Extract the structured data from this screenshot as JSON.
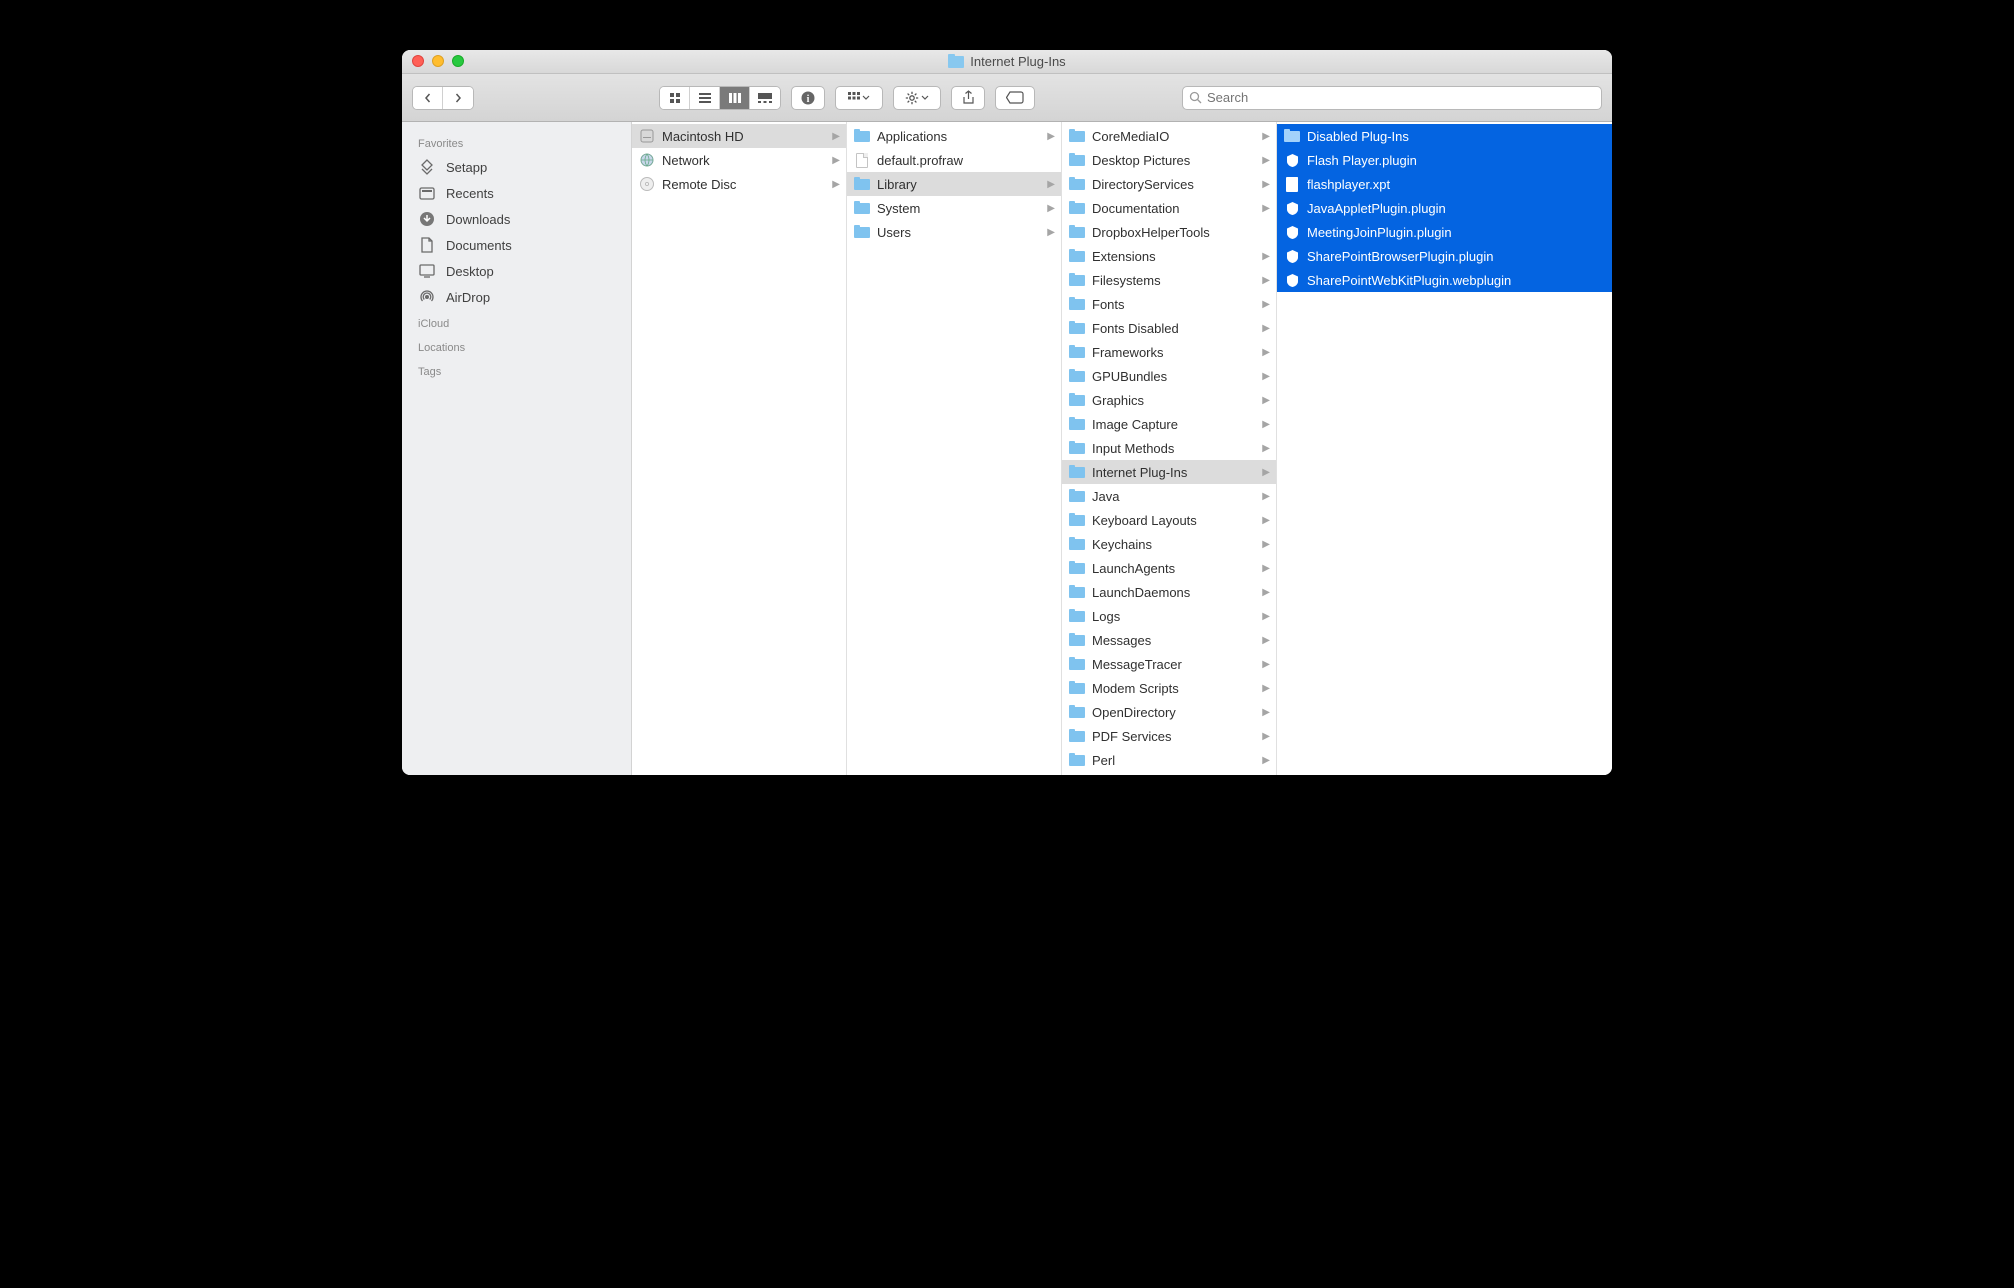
{
  "window": {
    "title": "Internet Plug-Ins"
  },
  "search": {
    "placeholder": "Search",
    "value": ""
  },
  "sidebar": {
    "sections": [
      {
        "header": "Favorites",
        "items": [
          {
            "icon": "apps",
            "label": "Setapp"
          },
          {
            "icon": "recents",
            "label": "Recents"
          },
          {
            "icon": "downloads",
            "label": "Downloads"
          },
          {
            "icon": "documents",
            "label": "Documents"
          },
          {
            "icon": "desktop",
            "label": "Desktop"
          },
          {
            "icon": "airdrop",
            "label": "AirDrop"
          }
        ]
      },
      {
        "header": "iCloud",
        "items": []
      },
      {
        "header": "Locations",
        "items": []
      },
      {
        "header": "Tags",
        "items": []
      }
    ]
  },
  "columns": [
    {
      "items": [
        {
          "type": "disk",
          "label": "Macintosh HD",
          "hasChildren": true,
          "selected": "gray"
        },
        {
          "type": "network",
          "label": "Network",
          "hasChildren": true
        },
        {
          "type": "opticaldisc",
          "label": "Remote Disc",
          "hasChildren": true
        }
      ]
    },
    {
      "items": [
        {
          "type": "folder",
          "label": "Applications",
          "hasChildren": true
        },
        {
          "type": "file",
          "label": "default.profraw",
          "hasChildren": false
        },
        {
          "type": "folder",
          "label": "Library",
          "hasChildren": true,
          "selected": "gray"
        },
        {
          "type": "folder",
          "label": "System",
          "hasChildren": true
        },
        {
          "type": "folder",
          "label": "Users",
          "hasChildren": true
        }
      ]
    },
    {
      "items": [
        {
          "type": "folder",
          "label": "CoreMediaIO",
          "hasChildren": true
        },
        {
          "type": "folder",
          "label": "Desktop Pictures",
          "hasChildren": true
        },
        {
          "type": "folder",
          "label": "DirectoryServices",
          "hasChildren": true
        },
        {
          "type": "folder",
          "label": "Documentation",
          "hasChildren": true
        },
        {
          "type": "folder",
          "label": "DropboxHelperTools",
          "hasChildren": false
        },
        {
          "type": "folder",
          "label": "Extensions",
          "hasChildren": true
        },
        {
          "type": "folder",
          "label": "Filesystems",
          "hasChildren": true
        },
        {
          "type": "folder",
          "label": "Fonts",
          "hasChildren": true
        },
        {
          "type": "folder",
          "label": "Fonts Disabled",
          "hasChildren": true
        },
        {
          "type": "folder",
          "label": "Frameworks",
          "hasChildren": true
        },
        {
          "type": "folder",
          "label": "GPUBundles",
          "hasChildren": true
        },
        {
          "type": "folder",
          "label": "Graphics",
          "hasChildren": true
        },
        {
          "type": "folder",
          "label": "Image Capture",
          "hasChildren": true
        },
        {
          "type": "folder",
          "label": "Input Methods",
          "hasChildren": true
        },
        {
          "type": "folder",
          "label": "Internet Plug-Ins",
          "hasChildren": true,
          "selected": "gray"
        },
        {
          "type": "folder",
          "label": "Java",
          "hasChildren": true
        },
        {
          "type": "folder",
          "label": "Keyboard Layouts",
          "hasChildren": true
        },
        {
          "type": "folder",
          "label": "Keychains",
          "hasChildren": true
        },
        {
          "type": "folder",
          "label": "LaunchAgents",
          "hasChildren": true
        },
        {
          "type": "folder",
          "label": "LaunchDaemons",
          "hasChildren": true
        },
        {
          "type": "folder",
          "label": "Logs",
          "hasChildren": true
        },
        {
          "type": "folder",
          "label": "Messages",
          "hasChildren": true
        },
        {
          "type": "folder",
          "label": "MessageTracer",
          "hasChildren": true
        },
        {
          "type": "folder",
          "label": "Modem Scripts",
          "hasChildren": true
        },
        {
          "type": "folder",
          "label": "OpenDirectory",
          "hasChildren": true
        },
        {
          "type": "folder",
          "label": "PDF Services",
          "hasChildren": true
        },
        {
          "type": "folder",
          "label": "Perl",
          "hasChildren": true
        }
      ]
    },
    {
      "items": [
        {
          "type": "folder",
          "label": "Disabled Plug-Ins",
          "hasChildren": false,
          "selected": "blue"
        },
        {
          "type": "plugin",
          "label": "Flash Player.plugin",
          "hasChildren": false,
          "selected": "blue"
        },
        {
          "type": "file",
          "label": "flashplayer.xpt",
          "hasChildren": false,
          "selected": "blue"
        },
        {
          "type": "plugin",
          "label": "JavaAppletPlugin.plugin",
          "hasChildren": false,
          "selected": "blue"
        },
        {
          "type": "plugin",
          "label": "MeetingJoinPlugin.plugin",
          "hasChildren": false,
          "selected": "blue"
        },
        {
          "type": "plugin",
          "label": "SharePointBrowserPlugin.plugin",
          "hasChildren": false,
          "selected": "blue"
        },
        {
          "type": "plugin",
          "label": "SharePointWebKitPlugin.webplugin",
          "hasChildren": false,
          "selected": "blue"
        }
      ]
    }
  ]
}
